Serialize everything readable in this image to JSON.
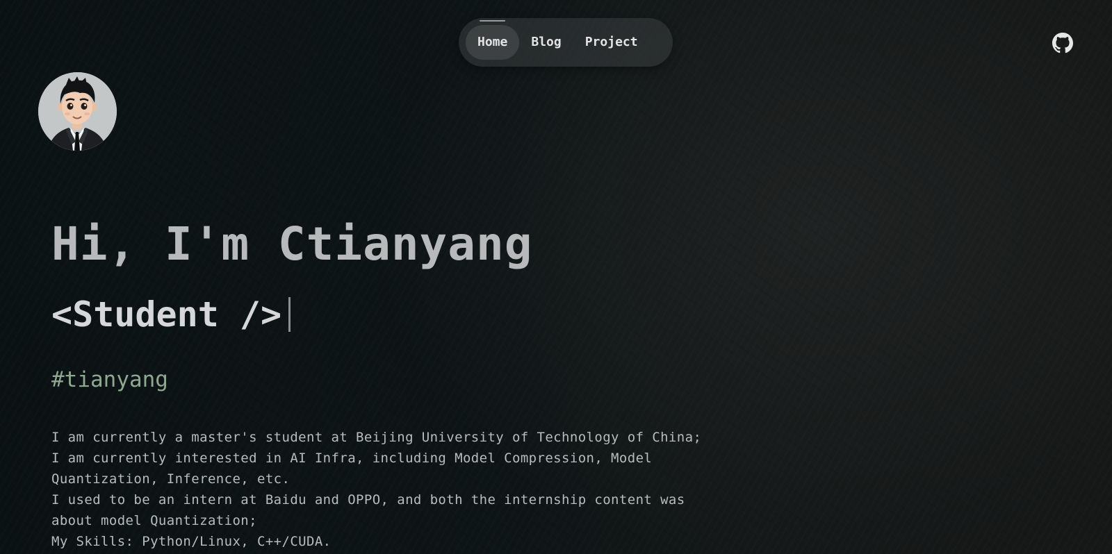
{
  "nav": {
    "items": [
      {
        "label": "Home",
        "active": true
      },
      {
        "label": "Blog",
        "active": false
      },
      {
        "label": "Project",
        "active": false
      }
    ]
  },
  "header": {
    "github_icon": "github-icon"
  },
  "profile": {
    "avatar_icon": "cartoon-avatar"
  },
  "hero": {
    "greeting": "Hi, I'm Ctianyang",
    "role": "<Student />",
    "hashtag": "#tianyang"
  },
  "bio": {
    "lines": [
      "I am currently a master's student at Beijing University of Technology of China;",
      "I am currently interested in AI Infra, including Model Compression, Model Quantization, Inference, etc.",
      "I used to be an intern at Baidu and OPPO, and both the internship content was about model Quantization;",
      "My Skills: Python/Linux, C++/CUDA."
    ]
  },
  "colors": {
    "background": "#0e1516",
    "hashtag": "#8fa891",
    "text": "#b9bbbc"
  }
}
